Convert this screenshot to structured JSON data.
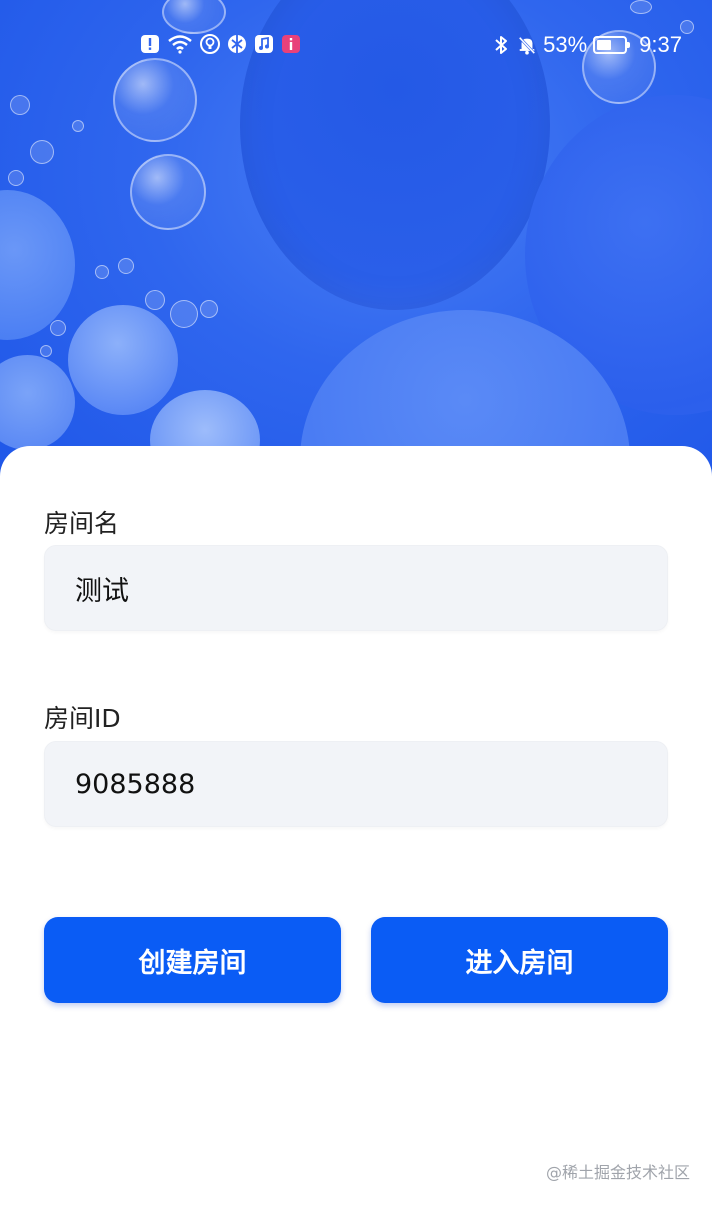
{
  "status_bar": {
    "battery_percent": "53%",
    "time": "9:37",
    "battery_level": 0.53,
    "left_icons": [
      "alert-icon",
      "wifi-icon",
      "lightbulb-icon",
      "app-icon",
      "music-icon",
      "notification-app-icon"
    ],
    "right_icons": [
      "bluetooth-icon",
      "mute-bell-icon",
      "battery-icon"
    ]
  },
  "form": {
    "room_name_label": "房间名",
    "room_name_value": "测试",
    "room_id_label": "房间ID",
    "room_id_value": "9085888"
  },
  "buttons": {
    "create_label": "创建房间",
    "enter_label": "进入房间"
  },
  "watermark": "@稀土掘金技术社区",
  "colors": {
    "primary": "#0a5cf5",
    "header_blue": "#2f66ee",
    "input_bg": "#f2f4f8"
  }
}
